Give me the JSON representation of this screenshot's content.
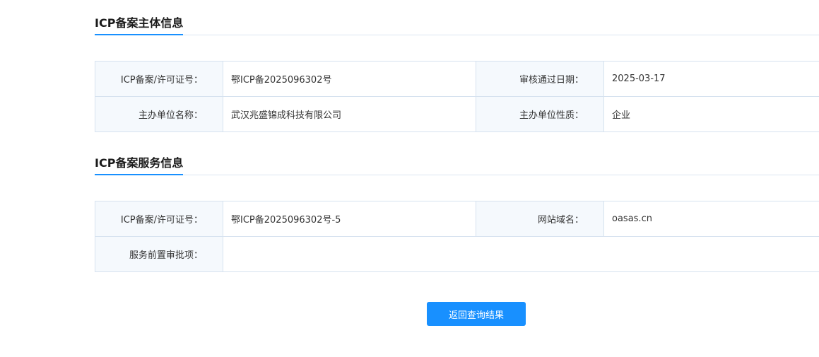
{
  "subject_section": {
    "title": "ICP备案主体信息",
    "rows": [
      [
        {
          "label": "ICP备案/许可证号：",
          "value": "鄂ICP备2025096302号"
        },
        {
          "label": "审核通过日期：",
          "value": "2025-03-17"
        }
      ],
      [
        {
          "label": "主办单位名称：",
          "value": "武汉兆盛锦成科技有限公司"
        },
        {
          "label": "主办单位性质：",
          "value": "企业"
        }
      ]
    ]
  },
  "service_section": {
    "title": "ICP备案服务信息",
    "rows": [
      [
        {
          "label": "ICP备案/许可证号：",
          "value": "鄂ICP备2025096302号-5"
        },
        {
          "label": "网站域名：",
          "value": "oasas.cn"
        }
      ],
      [
        {
          "label": "服务前置审批项：",
          "value": ""
        }
      ]
    ]
  },
  "back_button": {
    "label": "返回查询结果"
  },
  "colors": {
    "accent": "#1890ff",
    "label_bg": "#f5f9fd",
    "border": "#d6e2ef"
  }
}
